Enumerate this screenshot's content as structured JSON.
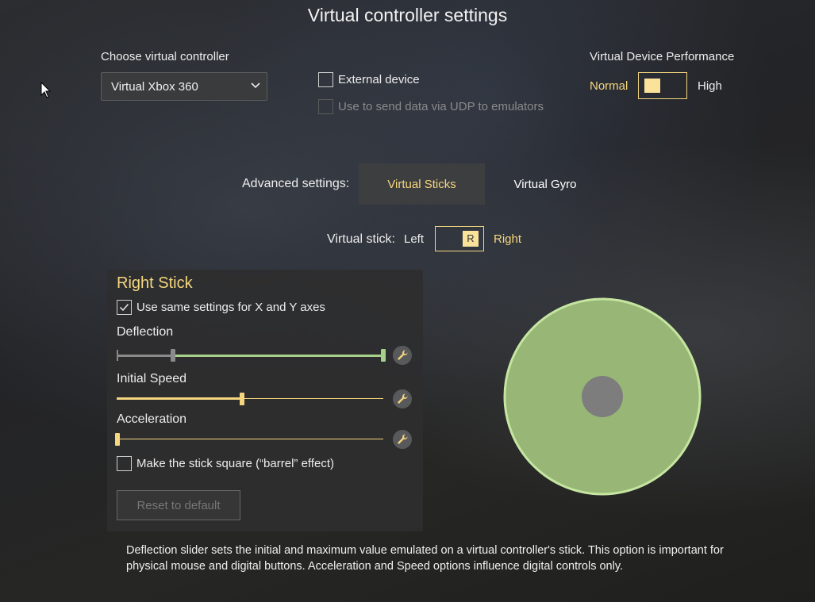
{
  "title": "Virtual controller settings",
  "controller": {
    "label": "Choose virtual controller",
    "selected": "Virtual Xbox 360",
    "external_device": {
      "label": "External device",
      "checked": false
    },
    "udp": {
      "label": "Use to send data via UDP to emulators",
      "checked": false,
      "disabled": true
    }
  },
  "performance": {
    "label": "Virtual Device Performance",
    "low": "Normal",
    "high": "High",
    "value": "Normal"
  },
  "advanced": {
    "label": "Advanced settings:",
    "tabs": [
      {
        "label": "Virtual Sticks",
        "active": true
      },
      {
        "label": "Virtual Gyro",
        "active": false
      }
    ]
  },
  "stick_selector": {
    "label": "Virtual stick:",
    "left": "Left",
    "right": "Right",
    "knob": "R",
    "value": "Right"
  },
  "panel": {
    "heading": "Right Stick",
    "same_axes": {
      "label": "Use same settings for X and Y axes",
      "checked": true
    },
    "deflection": {
      "label": "Deflection",
      "min": 0.21,
      "max": 1.0
    },
    "initial_speed": {
      "label": "Initial Speed",
      "value": 0.47
    },
    "acceleration": {
      "label": "Acceleration",
      "value": 0.0
    },
    "barrel": {
      "label": "Make the stick square (“barrel” effect)",
      "checked": false
    },
    "reset_label": "Reset to default"
  },
  "preview": {
    "fill_color": "#98b777",
    "border_color": "#c5e5a0",
    "dot_color": "#7d7d7d"
  },
  "note": "Deflection slider sets the initial and maximum value emulated on a virtual controller's stick. This option is important for physical mouse and digital buttons. Acceleration and Speed options influence digital controls only.",
  "colors": {
    "accent": "#f5d67f",
    "green": "#a7d08a"
  },
  "icons": {
    "cursor": "mouse-cursor-icon",
    "wrench": "wrench-icon",
    "dropdown": "chevron-down-icon",
    "check": "checkmark-icon"
  }
}
